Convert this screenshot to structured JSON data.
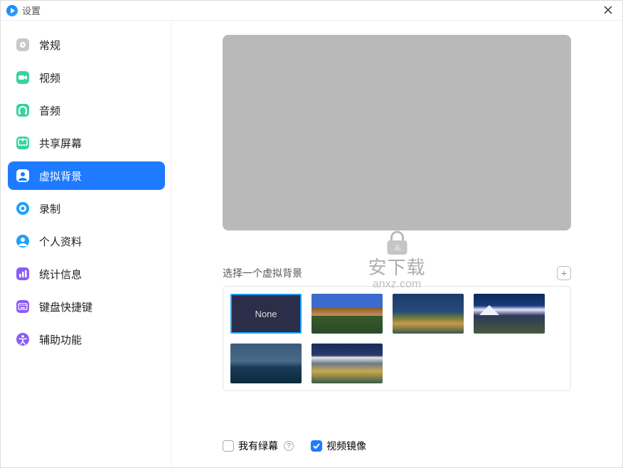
{
  "window": {
    "title": "设置"
  },
  "sidebar": {
    "items": [
      {
        "id": "general",
        "label": "常规",
        "icon": "gear",
        "active": false
      },
      {
        "id": "video",
        "label": "视频",
        "icon": "camera",
        "active": false
      },
      {
        "id": "audio",
        "label": "音频",
        "icon": "headphones",
        "active": false
      },
      {
        "id": "share",
        "label": "共享屏幕",
        "icon": "share",
        "active": false
      },
      {
        "id": "vbg",
        "label": "虚拟背景",
        "icon": "user-bg",
        "active": true
      },
      {
        "id": "record",
        "label": "录制",
        "icon": "record",
        "active": false
      },
      {
        "id": "profile",
        "label": "个人资料",
        "icon": "profile",
        "active": false
      },
      {
        "id": "stats",
        "label": "统计信息",
        "icon": "stats",
        "active": false
      },
      {
        "id": "shortcut",
        "label": "键盘快捷键",
        "icon": "keyboard",
        "active": false
      },
      {
        "id": "a11y",
        "label": "辅助功能",
        "icon": "accessibility",
        "active": false
      }
    ]
  },
  "main": {
    "select_label": "选择一个虚拟背景",
    "add_label": "+",
    "none_label": "None",
    "thumbs": [
      {
        "id": "none",
        "none": true
      },
      {
        "id": "t1"
      },
      {
        "id": "t2"
      },
      {
        "id": "t3"
      },
      {
        "id": "t4"
      },
      {
        "id": "t5"
      }
    ],
    "checkbox_greenscreen": {
      "label": "我有绿幕",
      "checked": false
    },
    "checkbox_mirror": {
      "label": "视频镜像",
      "checked": true
    }
  },
  "icons": {
    "gear": {
      "color": "#c8c8c8"
    },
    "camera": {
      "color": "#3ad29f"
    },
    "headphones": {
      "color": "#3ad29f"
    },
    "share": {
      "color": "#3ad29f"
    },
    "user-bg": {
      "color": "#ffffff"
    },
    "record": {
      "color": "#1e9fff"
    },
    "profile": {
      "color": "#1e9fff"
    },
    "stats": {
      "color": "#8b5cf6"
    },
    "keyboard": {
      "color": "#8b5cf6"
    },
    "accessibility": {
      "color": "#8b5cf6"
    }
  },
  "watermark": {
    "chinese": "安下载",
    "url": "anxz.com"
  }
}
